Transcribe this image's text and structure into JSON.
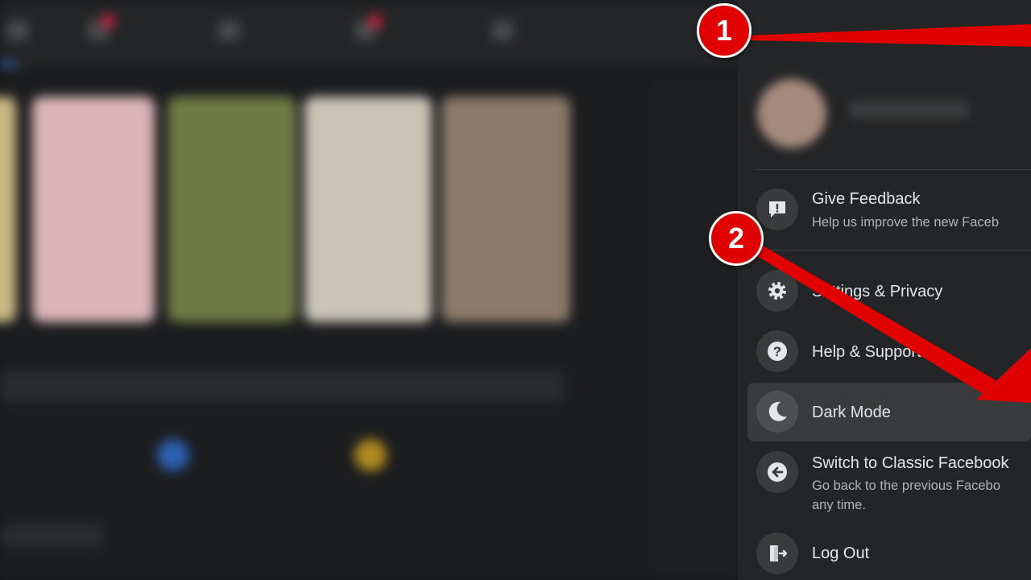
{
  "menu": {
    "give_feedback": {
      "title": "Give Feedback",
      "subtitle": "Help us improve the new Faceb",
      "icon": "feedback-icon"
    },
    "settings_privacy": {
      "title": "Settings & Privacy",
      "icon": "gear-icon"
    },
    "help_support": {
      "title": "Help & Support",
      "icon": "question-icon"
    },
    "dark_mode": {
      "title": "Dark Mode",
      "icon": "moon-icon"
    },
    "switch_classic": {
      "title": "Switch to Classic Facebook",
      "subtitle_line1": "Go back to the previous Facebo",
      "subtitle_line2": "any time.",
      "icon": "back-arrow-icon"
    },
    "log_out": {
      "title": "Log Out",
      "icon": "logout-icon"
    }
  },
  "annotations": {
    "step1": "1",
    "step2": "2",
    "color": "#e00000"
  },
  "colors": {
    "menu_bg": "#242526",
    "active_item_bg": "#3a3b3c",
    "text_primary": "#e4e6eb",
    "text_secondary": "#b0b3b8",
    "notification_red": "#e41e3f",
    "accent_blue": "#2d88ff"
  }
}
